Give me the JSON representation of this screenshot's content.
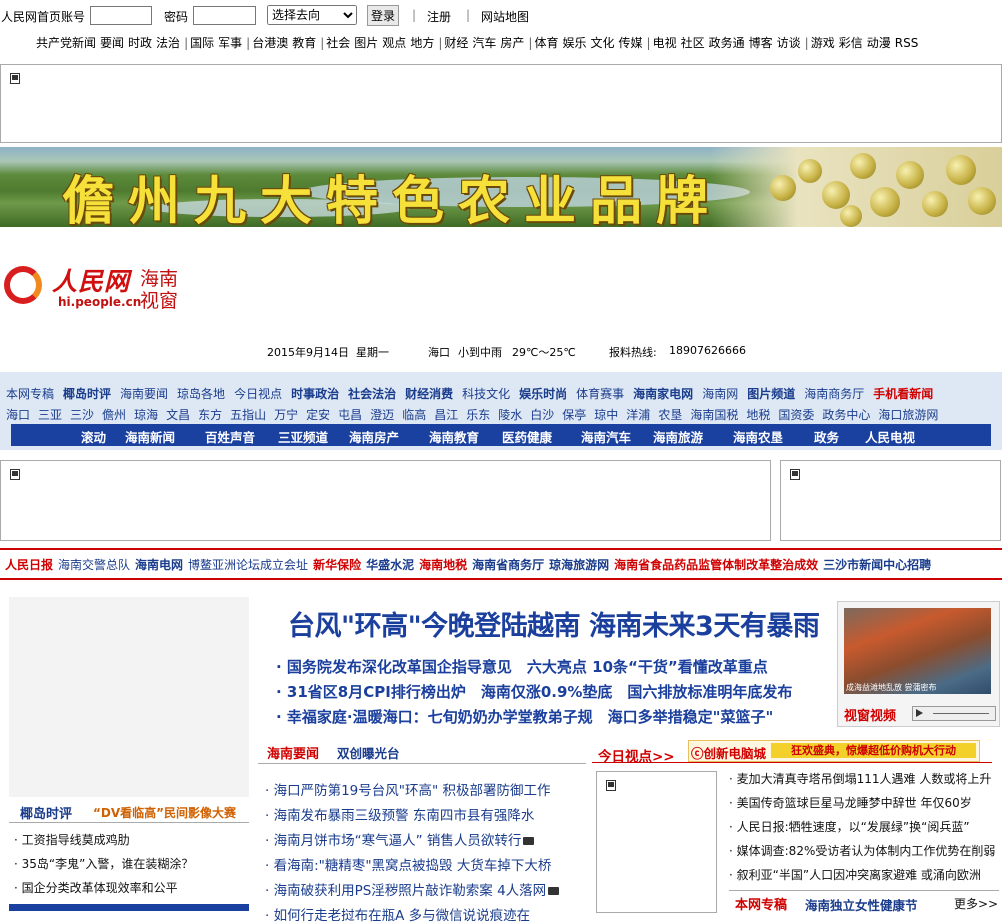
{
  "topbar": {
    "account_label": "人民网首页账号",
    "password_label": "密码",
    "destination_select": "选择去向",
    "login_button": "登录",
    "register": "注册",
    "sitemap": "网站地图"
  },
  "nav": [
    "共产党新闻",
    "要闻",
    "时政",
    "法治",
    "|",
    "国际",
    "军事",
    "|",
    "台港澳",
    "教育",
    "|",
    "社会",
    "图片",
    "观点",
    "地方",
    "|",
    "财经",
    "汽车",
    "房产",
    "|",
    "体育",
    "娱乐",
    "文化",
    "传媒",
    "|",
    "电视",
    "社区",
    "政务通",
    "博客",
    "访谈",
    "|",
    "游戏",
    "彩信",
    "动漫",
    "RSS"
  ],
  "banner": {
    "title": "儋州九大特色农业品牌"
  },
  "logo": {
    "name": "人民网",
    "url": "hi.people.cn",
    "region_line1": "海南",
    "region_line2": "视窗"
  },
  "dateline": {
    "date": "2015年9月14日",
    "weekday": "星期一",
    "city": "海口",
    "weather": "小到中雨",
    "temp": "29℃～25℃",
    "hotline_label": "报料热线:",
    "hotline": "18907626666"
  },
  "channels": {
    "row1": [
      {
        "t": "本网专稿",
        "s": ""
      },
      {
        "t": "椰岛时评",
        "s": "b"
      },
      {
        "t": "海南要闻",
        "s": ""
      },
      {
        "t": "琼岛各地",
        "s": ""
      },
      {
        "t": "今日视点",
        "s": ""
      },
      {
        "t": "时事政治",
        "s": "b"
      },
      {
        "t": "社会法治",
        "s": "b"
      },
      {
        "t": "财经消费",
        "s": "b"
      },
      {
        "t": "科技文化",
        "s": ""
      },
      {
        "t": "娱乐时尚",
        "s": "b"
      },
      {
        "t": "体育赛事",
        "s": ""
      },
      {
        "t": "海南家电网",
        "s": "b"
      },
      {
        "t": "海南网",
        "s": ""
      },
      {
        "t": "图片频道",
        "s": "b"
      },
      {
        "t": "海南商务厅",
        "s": ""
      },
      {
        "t": "手机看新闻",
        "s": "red"
      }
    ],
    "row2": [
      "海口",
      "三亚",
      "三沙",
      "儋州",
      "琼海",
      "文昌",
      "东方",
      "五指山",
      "万宁",
      "定安",
      "屯昌",
      "澄迈",
      "临高",
      "昌江",
      "乐东",
      "陵水",
      "白沙",
      "保亭",
      "琼中",
      "洋浦",
      "农垦",
      "海南国税",
      "地税",
      "国资委",
      "政务中心",
      "海口旅游网"
    ],
    "bar": [
      "滚动",
      "海南新闻",
      "百姓声音",
      "三亚频道",
      "海南房产",
      "海南教育",
      "医药健康",
      "海南汽车",
      "海南旅游",
      "海南农垦",
      "政务",
      "人民电视"
    ]
  },
  "linkbar": [
    {
      "t": "人民日报",
      "s": "r"
    },
    {
      "t": "海南交警总队",
      "s": ""
    },
    {
      "t": "海南电网",
      "s": "b"
    },
    {
      "t": "博鳌亚洲论坛成立会址",
      "s": ""
    },
    {
      "t": "新华保险",
      "s": "r"
    },
    {
      "t": "华盛水泥",
      "s": "b"
    },
    {
      "t": "海南地税",
      "s": "r"
    },
    {
      "t": "海南省商务厅",
      "s": "b"
    },
    {
      "t": "琼海旅游网",
      "s": "b"
    },
    {
      "t": "海南省食品药品监管体制改革整治成效",
      "s": "r"
    },
    {
      "t": "三沙市新闻中心招聘",
      "s": "b"
    }
  ],
  "left": {
    "head1": "椰岛时评",
    "head2": "“DV看临高”民间影像大赛",
    "items": [
      "工资指导线莫成鸡肋",
      "35岛“李鬼”入警，谁在装糊涂？",
      "国企分类改革体现效率和公平"
    ]
  },
  "headline": "台风\"环高\"今晚登陆越南 海南未来3天有暴雨",
  "subheadlines": [
    "国务院发布深化改革国企指导意见　六大亮点 10条“干货”看懂改革重点",
    "31省区8月CPI排行榜出炉　海南仅涨0.9%垫底　国六排放标准明年底发布",
    "幸福家庭·温暖海口：七旬奶奶办学堂教弟子规　海口多举措稳定\"菜篮子\""
  ],
  "video": {
    "label": "视窗视频",
    "caption": "成海益滩地乱放 尝蒲密布"
  },
  "midtabs": {
    "tab1": "海南要闻",
    "tab2": "双创曝光台"
  },
  "midnews": [
    {
      "t": "海口严防第19号台风\"环高\" 积极部署防御工作",
      "cam": false
    },
    {
      "t": "海南发布暴雨三级预警 东南四市县有强降水",
      "cam": false
    },
    {
      "t": "海南月饼市场“寒气逼人” 销售人员欲转行",
      "cam": true
    },
    {
      "t": "看海南:\"糖精枣\"黑窝点被捣毁 大货车掉下大桥",
      "cam": false
    },
    {
      "t": "海南破获利用PS淫秽照片敲诈勒索案 4人落网",
      "cam": true
    },
    {
      "t": "如何行走老挝布在瓶A 多与微信说说痕迹在",
      "cam": false
    }
  ],
  "today": {
    "head": "今日视点>>"
  },
  "adstrip": {
    "brand": "ⓒ创新电脑城",
    "promo": "狂欢盛典，惊爆超低价购机大行动"
  },
  "rightnews": [
    "麦加大清真寺塔吊倒塌111人遇难 人数或将上升",
    "美国传奇篮球巨星马龙睡梦中辞世 年仅60岁",
    "人民日报:牺牲速度，以“发展绿”换“阅兵蓝”",
    "媒体调查:82%受访者认为体制内工作优势在削弱",
    "叙利亚“半国”人口因冲突离家避难 或涌向欧洲"
  ],
  "rsection": {
    "head": "本网专稿",
    "title": "海南独立女性健康节",
    "more": "更多>>"
  }
}
